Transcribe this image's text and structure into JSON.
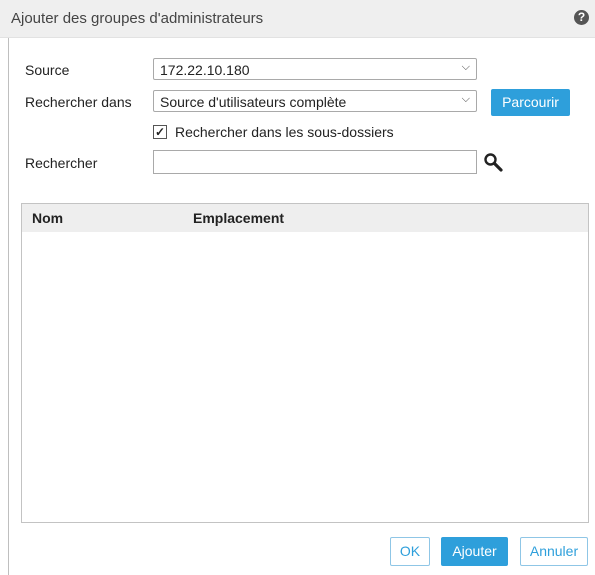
{
  "dialog": {
    "title": "Ajouter des groupes d'administrateurs",
    "help": "?"
  },
  "form": {
    "source_label": "Source",
    "source_value": "172.22.10.180",
    "search_in_label": "Rechercher dans",
    "search_in_value": "Source d'utilisateurs complète",
    "browse_label": "Parcourir",
    "subfolders_label": "Rechercher dans les sous-dossiers",
    "subfolders_checked": true,
    "search_label": "Rechercher",
    "search_value": ""
  },
  "table": {
    "columns": [
      "Nom",
      "Emplacement"
    ],
    "rows": []
  },
  "footer": {
    "ok_label": "OK",
    "add_label": "Ajouter",
    "cancel_label": "Annuler"
  },
  "colors": {
    "accent": "#2e9fdb",
    "titlebar": "#efefef"
  }
}
